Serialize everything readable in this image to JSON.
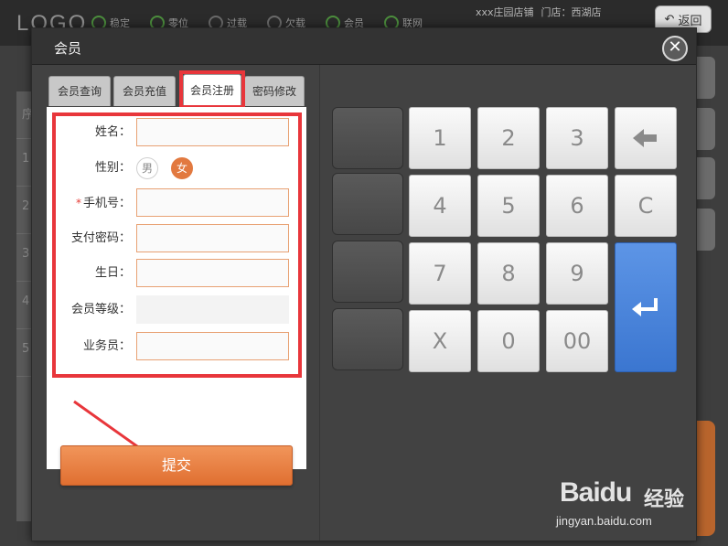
{
  "app": {
    "logo": "LOGO",
    "nav": [
      {
        "label": "稳定",
        "icon": "signal-bars-icon"
      },
      {
        "label": "零位",
        "icon": "ring-icon"
      },
      {
        "label": "过载",
        "icon": "power-icon"
      },
      {
        "label": "欠载",
        "icon": "minus-circle-icon"
      },
      {
        "label": "会员",
        "icon": "user-icon"
      },
      {
        "label": "联网",
        "icon": "wifi-icon"
      }
    ],
    "store_name": "xxx庄园店铺",
    "store_branch": "门店：西湖店",
    "back_label": "返回",
    "bg_rows": [
      "序",
      "1",
      "2",
      "3",
      "4",
      "5"
    ]
  },
  "modal": {
    "title": "会员",
    "close_icon": "close-icon"
  },
  "tabs": [
    {
      "label": "会员查询",
      "active": false
    },
    {
      "label": "会员充值",
      "active": false
    },
    {
      "label": "会员注册",
      "active": true
    },
    {
      "label": "密码修改",
      "active": false
    }
  ],
  "form": {
    "name_label": "姓名：",
    "gender_label": "性别：",
    "gender_male": "男",
    "gender_female": "女",
    "phone_required_mark": "*",
    "phone_label": "手机号：",
    "pay_password_label": "支付密码：",
    "birthday_label": "生日：",
    "level_label": "会员等级：",
    "salesperson_label": "业务员：",
    "submit_label": "提交"
  },
  "keypad": {
    "keys": [
      "1",
      "2",
      "3",
      "4",
      "5",
      "6",
      "7",
      "8",
      "9",
      "X",
      "0",
      "00"
    ],
    "clear_label": "C",
    "backspace_icon": "backspace-arrow-icon",
    "enter_icon": "enter-return-icon"
  },
  "watermark": {
    "brand": "Baidu",
    "brand_cn": "经验",
    "url": "jingyan.baidu.com"
  },
  "colors": {
    "highlight": "#e8363b",
    "accent_orange": "#e2793f",
    "enter_blue": "#3b76d0"
  }
}
